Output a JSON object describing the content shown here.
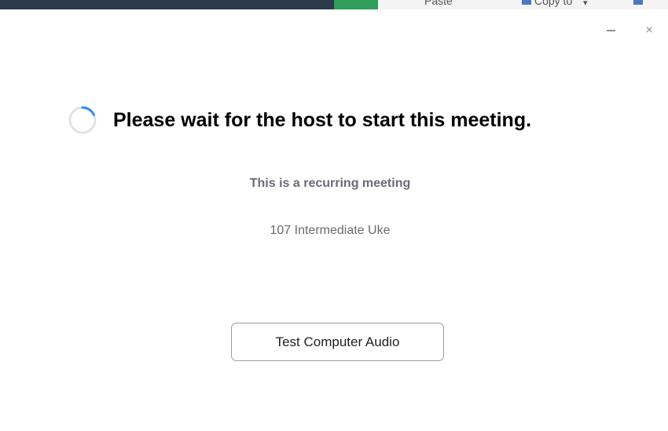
{
  "background_window": {
    "toolbar_fragment_1": "Paste",
    "toolbar_fragment_2": "Copy to",
    "toolbar_fragment_3": "▾"
  },
  "window_controls": {
    "minimize_icon": "minimize-icon",
    "close_icon": "close-icon",
    "close_glyph": "×"
  },
  "main": {
    "spinner_icon": "loading-spinner-icon",
    "heading": "Please wait for the host to start this meeting.",
    "subtitle": "This is a recurring meeting",
    "meeting_name": "107 Intermediate Uke"
  },
  "actions": {
    "test_audio_label": "Test Computer Audio"
  },
  "colors": {
    "spinner_track": "#e3e3e3",
    "spinner_arc": "#2d8cff",
    "subtitle": "#6b6b78"
  }
}
